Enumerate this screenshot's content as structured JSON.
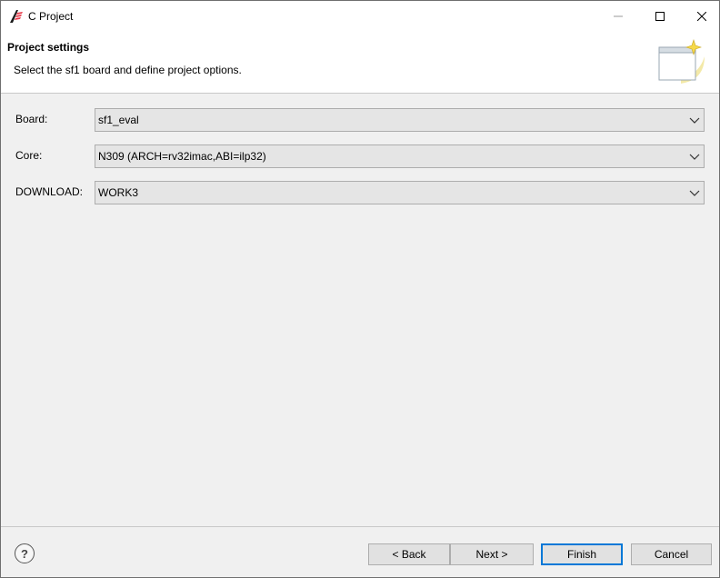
{
  "window": {
    "title": "C Project"
  },
  "header": {
    "title": "Project settings",
    "description": "Select the sf1 board and define project options."
  },
  "form": {
    "board": {
      "label": "Board:",
      "value": "sf1_eval"
    },
    "core": {
      "label": "Core:",
      "value": "N309 (ARCH=rv32imac,ABI=ilp32)"
    },
    "download": {
      "label": "DOWNLOAD:",
      "value": "WORK3"
    }
  },
  "footer": {
    "help": "?",
    "back": "< Back",
    "next": "Next >",
    "finish": "Finish",
    "cancel": "Cancel"
  }
}
